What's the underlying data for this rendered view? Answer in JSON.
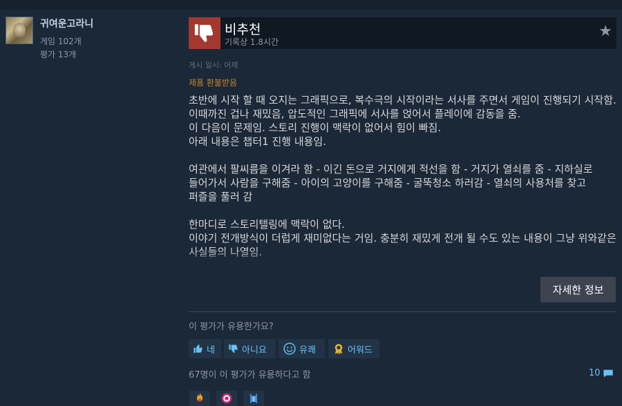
{
  "user": {
    "name": "귀여운고라니",
    "games": "게임 102개",
    "reviews": "평가 13개"
  },
  "review": {
    "verdict": "비추천",
    "hours": "기록상 1.8시간",
    "posted": "게시 일시: 어제",
    "refunded": "제품 환불받음",
    "body": "초반에 시작 할 때 오지는 그래픽으로, 복수극의 시작이라는 서사를 주면서 게임이 진행되기 시작함.\n이때까진 겁나 재밌음, 압도적인 그래픽에 서사를 얹어서 플레이에 감동을 줌.\n이 다음이 문제임. 스토리 진행이 맥락이 없어서 힘이 빠짐.\n아래 내용은 챕터1 진행 내용임.\n\n여관에서 팔씨름을 이겨라 함 - 이긴 돈으로 거지에게 적선을 함 - 거지가 열쇠를 줌 - 지하실로 들어가서 사람을 구해줌 - 아이의 고양이를 구해줌 - 굴뚝청소 하러감 - 열쇠의 사용처를 찾고 퍼즐을 풀러 감\n\n한마디로 스토리텔링에 맥락이 없다.\n이야기 전개방식이 더럽게 재미없다는 거임. 충분히 재밌게 전개 될 수도 있는 내용이 그냥 위와같은 사실들의 나열임.",
    "more_button": "자세한 정보",
    "helpful_question": "이 평가가 유용한가요?",
    "votes": {
      "yes": "네",
      "no": "아니요",
      "funny": "유쾌",
      "award": "어워드"
    },
    "helpful_count": "67명이 이 평가가 유용하다고 함",
    "comment_count": "10"
  },
  "colors": {
    "background": "#1b2838",
    "thumb_down": "#a3382e",
    "link_blue": "#67c1f5",
    "refund_orange": "#c8852b"
  }
}
